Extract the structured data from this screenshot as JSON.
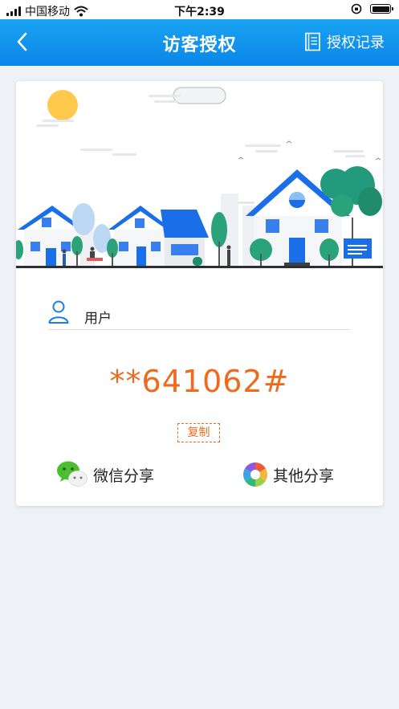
{
  "status_bar": {
    "carrier": "中国移动",
    "time": "下午2:39"
  },
  "nav": {
    "title": "访客授权",
    "records_label": "授权记录"
  },
  "card": {
    "user_label": "用户",
    "code": "**641062#",
    "copy_label": "复制",
    "share_wechat_label": "微信分享",
    "share_other_label": "其他分享"
  },
  "colors": {
    "nav_blue": "#0b86e9",
    "accent_orange": "#f06a1e"
  }
}
